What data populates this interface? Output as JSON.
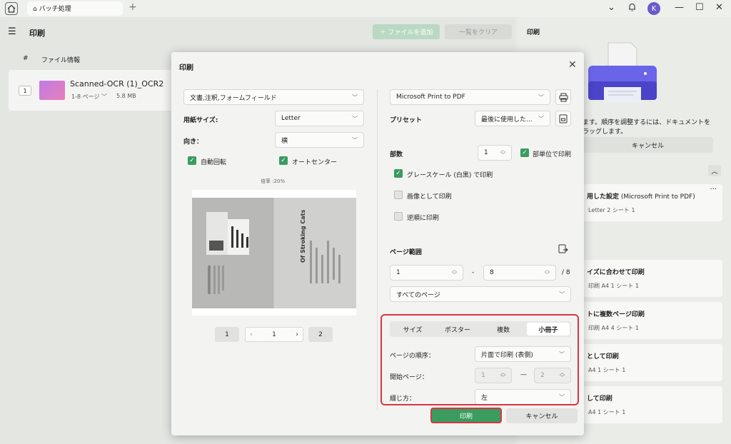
{
  "titlebar": {
    "tab_label": "バッチ処理",
    "avatar_letter": "K"
  },
  "left_panel": {
    "title": "印刷",
    "add_file": "＋ ファイルを追加",
    "clear_list": "一覧をクリア",
    "col_hash": "#",
    "col_info": "ファイル情報",
    "file": {
      "index": "1",
      "name": "Scanned-OCR (1)_OCR2",
      "pages": "1-8 ページ ﹀",
      "size": "5.8 MB"
    }
  },
  "right_panel": {
    "title": "印刷",
    "hint_line1": "ます。順序を調整するには、ドキュメントを",
    "hint_line2": "ラッグします。",
    "cancel": "キャンセル",
    "presets": [
      {
        "title": "用した設定",
        "title_extra": "(Microsoft Print to PDF)",
        "meta": "Letter   2 シート   1",
        "dots": "···"
      },
      {
        "title": "イズに合わせて印刷",
        "meta": "印刷   A4   1 シート   1"
      },
      {
        "title": "トに複数ページ印刷",
        "meta": "印刷   A4   4 シート   1"
      },
      {
        "title": "として印刷",
        "meta": "A4   1 シート   1"
      },
      {
        "title": "して印刷",
        "meta": "A4   1 シート   1"
      }
    ]
  },
  "dialog": {
    "title": "印刷",
    "content_select": "文書,注釈,フォームフィールド",
    "paper_size_label": "用紙サイズ:",
    "paper_size": "Letter",
    "orientation_label": "向き：",
    "orientation": "横",
    "auto_rotate": "自動回転",
    "auto_center": "オートセンター",
    "scale_text": "倍率 :20%",
    "preview_title": "Of Stroking Cats",
    "pager": {
      "first": "1",
      "current": "1",
      "last": "2"
    },
    "printer": "Microsoft Print to PDF",
    "preset_label": "プリセット",
    "preset_value": "最後に使用した...",
    "copies_label": "部数",
    "copies": "1",
    "collate": "部単位で印刷",
    "grayscale": "グレースケール (白黒) で印刷",
    "as_image": "画像として印刷",
    "reverse": "逆順に印刷",
    "page_range_label": "ページ範囲",
    "range_from": "1",
    "range_dash": "-",
    "range_to": "8",
    "range_total": "/ 8",
    "all_pages": "すべてのページ",
    "tabs": [
      "サイズ",
      "ポスター",
      "複数",
      "小冊子"
    ],
    "page_order_label": "ページの順序：",
    "page_order": "片面で印刷 (表側)",
    "start_page_label": "開始ページ：",
    "start_from": "1",
    "start_dash": "—",
    "start_to": "2",
    "binding_label": "綴じ方：",
    "binding": "左",
    "print": "印刷",
    "cancel": "キャンセル"
  },
  "colors": {
    "accent_green": "#3a9c5f",
    "highlight_red": "#d9363e"
  }
}
